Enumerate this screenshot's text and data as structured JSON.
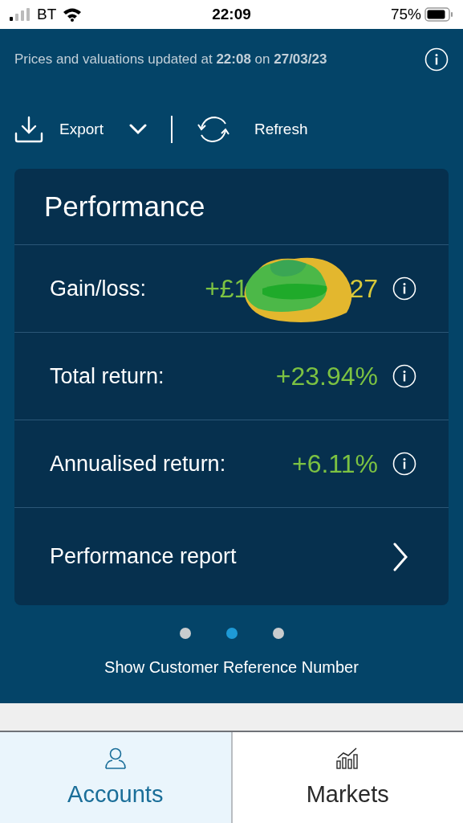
{
  "status_bar": {
    "carrier": "BT",
    "time": "22:09",
    "battery_percent": "75%"
  },
  "update_notice": "Prices and valuations updated at **22:08** on **27/03/23**",
  "toolbar": {
    "export": "Export",
    "refresh": "Refresh"
  },
  "card": {
    "title": "Performance",
    "rows": [
      {
        "kind": "metric",
        "label": "Gain/loss:",
        "value_start": "+£1",
        "value_end": "27",
        "redacted": true
      },
      {
        "kind": "metric",
        "label": "Total return:",
        "value": "+23.94%"
      },
      {
        "kind": "metric",
        "label": "Annualised return:",
        "value": "+6.11%"
      },
      {
        "kind": "link",
        "label": "Performance report"
      }
    ]
  },
  "pager": [
    {
      "selected": false
    },
    {
      "selected": true
    },
    {
      "selected": false
    }
  ],
  "reference_link": "Show Customer Reference Number",
  "nav": [
    {
      "kind": "accounts",
      "label": "Accounts",
      "selected": true
    },
    {
      "kind": "markets",
      "label": "Markets",
      "selected": false
    }
  ]
}
